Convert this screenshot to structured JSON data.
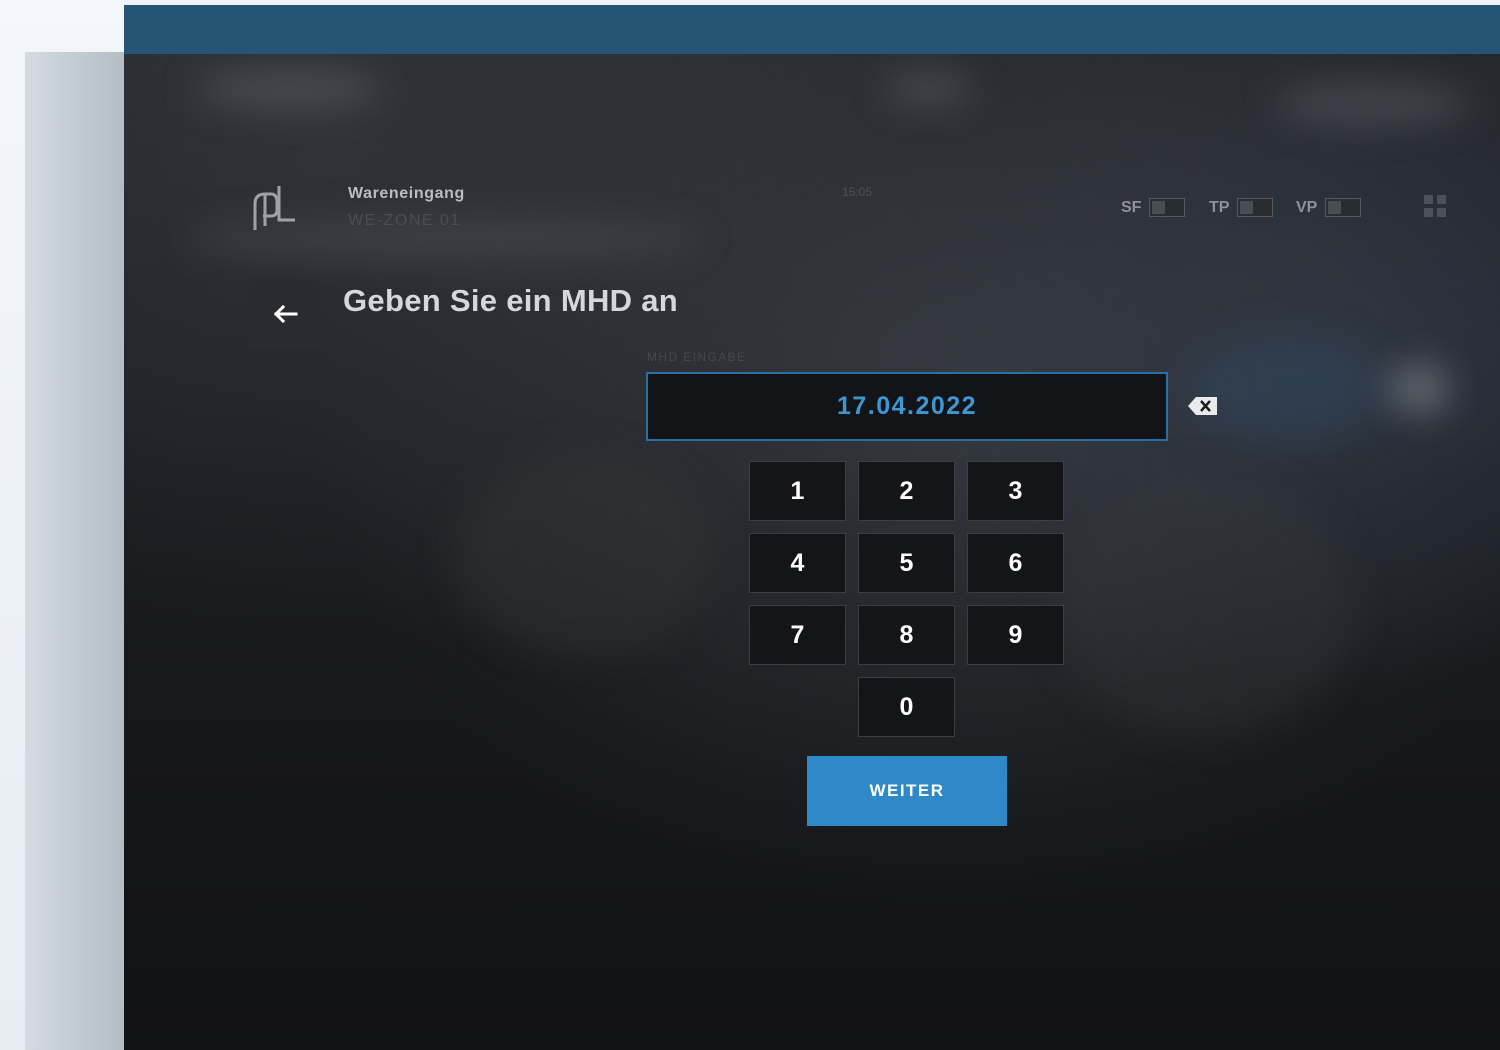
{
  "header": {
    "title": "Wareneingang",
    "zone": "WE-ZONE 01",
    "time": "15:05"
  },
  "toggles": [
    {
      "label": "SF",
      "state": "off"
    },
    {
      "label": "TP",
      "state": "off"
    },
    {
      "label": "VP",
      "state": "off"
    }
  ],
  "page": {
    "title": "Geben Sie ein MHD an"
  },
  "mhd_input": {
    "label": "MHD EINGABE",
    "value": "17.04.2022"
  },
  "keypad": {
    "keys": [
      "1",
      "2",
      "3",
      "4",
      "5",
      "6",
      "7",
      "8",
      "9",
      "0"
    ]
  },
  "actions": {
    "next_label": "WEITER"
  },
  "colors": {
    "topbar": "#255477",
    "accent": "#2f88c8",
    "input_text": "#3e97d3"
  }
}
